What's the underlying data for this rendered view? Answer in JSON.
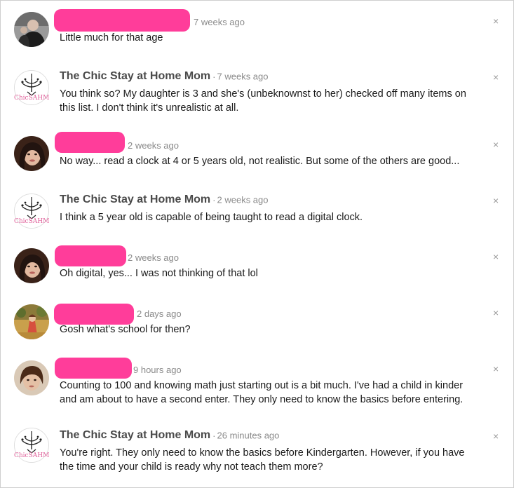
{
  "comments": [
    {
      "author": "",
      "author_redacted": true,
      "time": "7 weeks ago",
      "text": "Little much for that age",
      "avatar": "man-photo"
    },
    {
      "author": "The Chic Stay at Home Mom",
      "author_redacted": false,
      "time": "7 weeks ago",
      "text": "You think so? My daughter is 3 and she's (unbeknownst to her) checked off many items on this list. I don't think it's unrealistic at all.",
      "avatar": "chandelier-logo",
      "logo_text": "ChicSAHM"
    },
    {
      "author": "",
      "author_redacted": true,
      "time": "2 weeks ago",
      "text": "No way... read a clock at 4 or 5 years old, not realistic. But some of the others are good...",
      "avatar": "woman-photo"
    },
    {
      "author": "The Chic Stay at Home Mom",
      "author_redacted": false,
      "time": "2 weeks ago",
      "text": "I think a 5 year old is capable of being taught to read a digital clock.",
      "avatar": "chandelier-logo",
      "logo_text": "ChicSAHM"
    },
    {
      "author": "",
      "author_redacted": true,
      "time": "2 weeks ago",
      "text": "Oh digital, yes... I was not thinking of that lol",
      "avatar": "woman-photo"
    },
    {
      "author": "",
      "author_redacted": true,
      "time": "2 days ago",
      "text": "Gosh what's school for then?",
      "avatar": "garden-photo"
    },
    {
      "author": "",
      "author_redacted": true,
      "time": "9 hours ago",
      "text": "Counting to 100 and knowing math just starting out is a bit much. I've had a child in kinder and am about to have a second enter. They only need to know the basics before entering.",
      "avatar": "woman-photo-2"
    },
    {
      "author": "The Chic Stay at Home Mom",
      "author_redacted": false,
      "time": "26 minutes ago",
      "text": "You're right. They only need to know the basics before Kindergarten. However, if you have the time and your child is ready why not teach them more?",
      "avatar": "chandelier-logo",
      "logo_text": "ChicSAHM"
    }
  ],
  "close_label": "×",
  "colors": {
    "redaction": "#ff3d9a",
    "author": "#4a4a4a",
    "meta": "#8a8a8a",
    "body_text": "#1a1a1a",
    "logo_text": "#e0609a"
  }
}
